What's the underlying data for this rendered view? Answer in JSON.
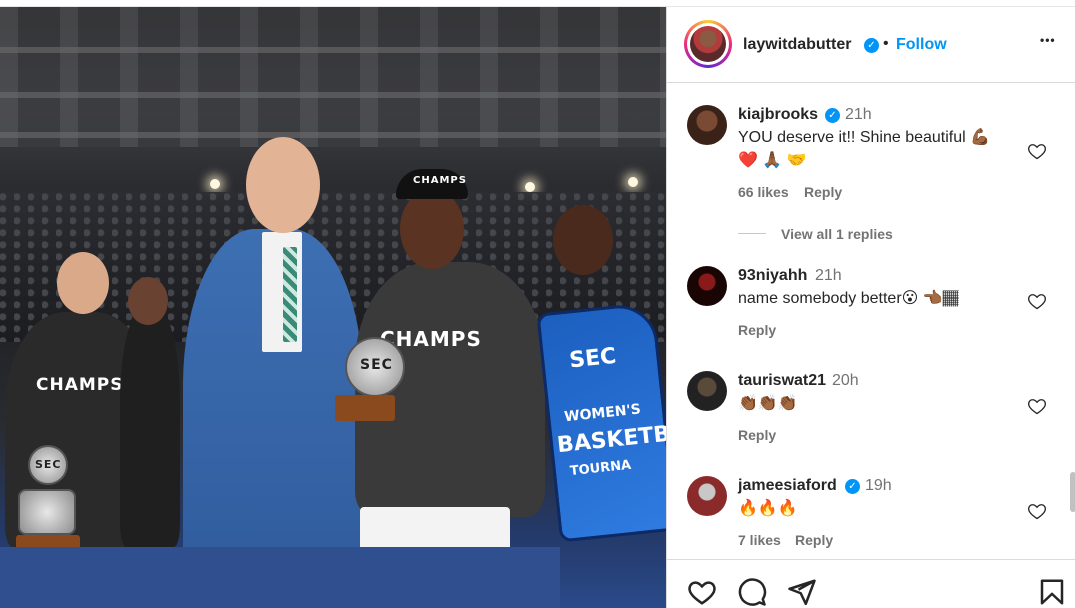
{
  "post": {
    "username": "laywitdabutter",
    "follow_label": "Follow",
    "separator": "•",
    "more_label": "•••"
  },
  "photo": {
    "shirt_text_1": "CHAMPS",
    "shirt_text_2": "CHAMPS",
    "hat_text": "CHAMPS",
    "sign_logo": "SEC",
    "sign_line_1": "WOMEN'S",
    "sign_line_2": "BASKETB",
    "sign_line_3": "TOURNA",
    "trophy_logo": "SEC"
  },
  "comments": [
    {
      "username": "kiajbrooks",
      "verified": true,
      "time": "21h",
      "text_line_1": "YOU deserve it!! Shine beautiful 💪🏾",
      "text_line_2": "❤️ 🙏🏾 🤝",
      "likes": "66 likes",
      "reply": "Reply",
      "view_replies": "View all 1 replies"
    },
    {
      "username": "93niyahh",
      "verified": false,
      "time": "21h",
      "text_line_1": "name somebody better😮 👈🏾🏾",
      "reply": "Reply"
    },
    {
      "username": "tauriswat21",
      "verified": false,
      "time": "20h",
      "text_line_1": "👏🏾👏🏾👏🏾",
      "reply": "Reply"
    },
    {
      "username": "jameesiaford",
      "verified": true,
      "time": "19h",
      "text_line_1": "🔥🔥🔥",
      "likes": "7 likes",
      "reply": "Reply"
    }
  ],
  "icons": {
    "verified": "verified-badge-icon",
    "like": "heart-icon",
    "comment": "comment-bubble-icon",
    "share": "paper-plane-icon",
    "save": "bookmark-icon"
  },
  "colors": {
    "accent": "#0095f6",
    "muted": "#737373",
    "text": "#262626"
  }
}
